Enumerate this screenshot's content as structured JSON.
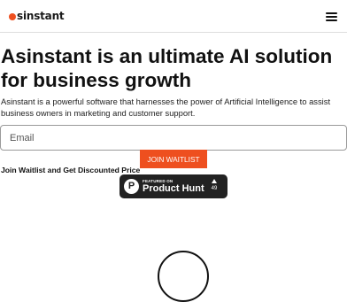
{
  "header": {
    "logo_text": "sinstant",
    "logo_accent": "#ee4f1f",
    "menu_icon": "hamburger-menu-icon"
  },
  "hero": {
    "headline": "Asinstant is an ultimate AI solution for business growth",
    "description": "Asinstant is a powerful software that harnesses the power of Artificial Intelligence to assist business owners in marketing and customer support."
  },
  "signup": {
    "email_placeholder": "Email",
    "email_value": "",
    "button_label": "JOIN WAITLIST",
    "button_color": "#ee4f1f",
    "caption": "Join Waitlist and Get Discounted Price"
  },
  "product_hunt": {
    "featured_label": "FEATURED ON",
    "name": "Product Hunt",
    "logo_letter": "P",
    "upvote_icon": "upvote-triangle-icon",
    "upvotes": "49"
  }
}
